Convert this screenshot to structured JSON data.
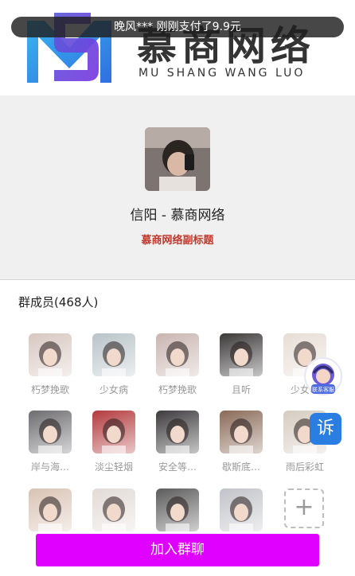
{
  "toast": {
    "text": "晚风*** 刚刚支付了9.9元"
  },
  "logo": {
    "title": "慕商网络",
    "subtitle": "MU SHANG WANG LUO"
  },
  "group": {
    "name": "信阳 - 慕商网络",
    "subtitle": "慕商网络副标题"
  },
  "members": {
    "title": "群成员(468人)",
    "items": [
      {
        "name": "朽梦挽歌",
        "color": "#d8c7c0"
      },
      {
        "name": "少女病",
        "color": "#b9c4c8"
      },
      {
        "name": "朽梦挽歌",
        "color": "#c9b5b0"
      },
      {
        "name": "且听",
        "color": "#3b3838"
      },
      {
        "name": "少女の",
        "color": "#e7ddd5"
      },
      {
        "name": "岸与海…",
        "color": "#6d6c70"
      },
      {
        "name": "淡尘轻烟",
        "color": "#b33a3d"
      },
      {
        "name": "安全等…",
        "color": "#3c3a3c"
      },
      {
        "name": "歇斯底…",
        "color": "#8a6a58"
      },
      {
        "name": "雨后彩虹",
        "color": "#d6ccc0"
      },
      {
        "name": "",
        "color": "#d9c3b4"
      },
      {
        "name": "",
        "color": "#e2dbd7"
      },
      {
        "name": "",
        "color": "#5b5b5b"
      },
      {
        "name": "",
        "color": "#c2c3c9"
      }
    ]
  },
  "add_label": "+",
  "join_button": "加入群聊",
  "service": {
    "label": "联系客服"
  },
  "complaint": {
    "label": "诉"
  },
  "colors": {
    "accent": "#e000ff",
    "subtitle_red": "#c0392b",
    "complaint_blue": "#2a7de1"
  }
}
